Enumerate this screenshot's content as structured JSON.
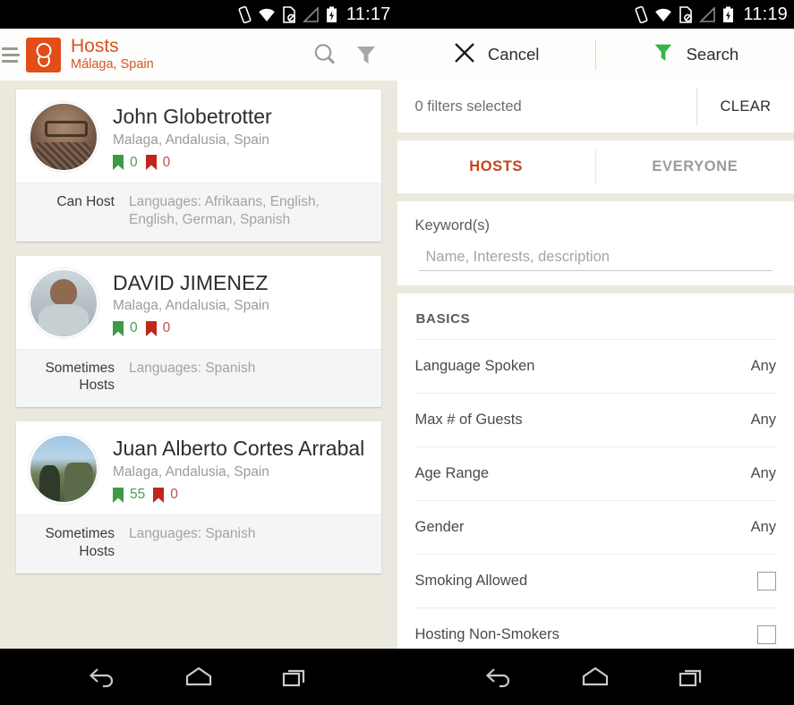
{
  "left": {
    "status_bar": {
      "time": "11:17",
      "icons": [
        "vibrate-icon",
        "wifi-icon",
        "sdcard-blocked-icon",
        "signal-icon",
        "battery-charging-icon"
      ]
    },
    "app_bar": {
      "title": "Hosts",
      "subtitle": "Málaga, Spain",
      "logo_name": "app-logo",
      "search_icon": "search-icon",
      "filter_icon": "filter-icon",
      "drawer_icon": "hamburger-icon"
    },
    "hosts": [
      {
        "name": "John Globetrotter",
        "location": "Malaga, Andalusia, Spain",
        "green_count": "0",
        "red_count": "0",
        "host_status": "Can Host",
        "languages": "Languages: Afrikaans, English, English, German, Spanish"
      },
      {
        "name": "DAVID JIMENEZ",
        "location": "Malaga, Andalusia, Spain",
        "green_count": "0",
        "red_count": "0",
        "host_status": "Sometimes Hosts",
        "languages": "Languages: Spanish"
      },
      {
        "name": "Juan Alberto Cortes Arrabal",
        "location": "Malaga, Andalusia, Spain",
        "green_count": "55",
        "red_count": "0",
        "host_status": "Sometimes Hosts",
        "languages": "Languages: Spanish"
      }
    ]
  },
  "right": {
    "status_bar": {
      "time": "11:19"
    },
    "app_bar": {
      "cancel_label": "Cancel",
      "search_label": "Search",
      "cancel_icon": "close-icon",
      "search_icon": "funnel-icon"
    },
    "filter_summary": {
      "text": "0 filters selected",
      "clear_label": "CLEAR"
    },
    "tabs": [
      {
        "label": "HOSTS",
        "active": true
      },
      {
        "label": "EVERYONE",
        "active": false
      }
    ],
    "keyword": {
      "label": "Keyword(s)",
      "value": "",
      "placeholder": "Name, Interests, description"
    },
    "basics": {
      "header": "BASICS",
      "rows": [
        {
          "label": "Language Spoken",
          "value": "Any",
          "type": "value"
        },
        {
          "label": "Max # of Guests",
          "value": "Any",
          "type": "value"
        },
        {
          "label": "Age Range",
          "value": "Any",
          "type": "value"
        },
        {
          "label": "Gender",
          "value": "Any",
          "type": "value"
        },
        {
          "label": "Smoking Allowed",
          "value": "",
          "type": "checkbox"
        },
        {
          "label": "Hosting Non-Smokers",
          "value": "",
          "type": "checkbox"
        }
      ]
    }
  },
  "nav_bar": {
    "back_label": "back-icon",
    "home_label": "home-icon",
    "recents_label": "recents-icon"
  },
  "colors": {
    "brand_orange": "#d85422",
    "tab_active": "#c2451b",
    "flag_green": "#4f9b55",
    "flag_red": "#c0392b",
    "page_bg": "#ebe8dd"
  }
}
